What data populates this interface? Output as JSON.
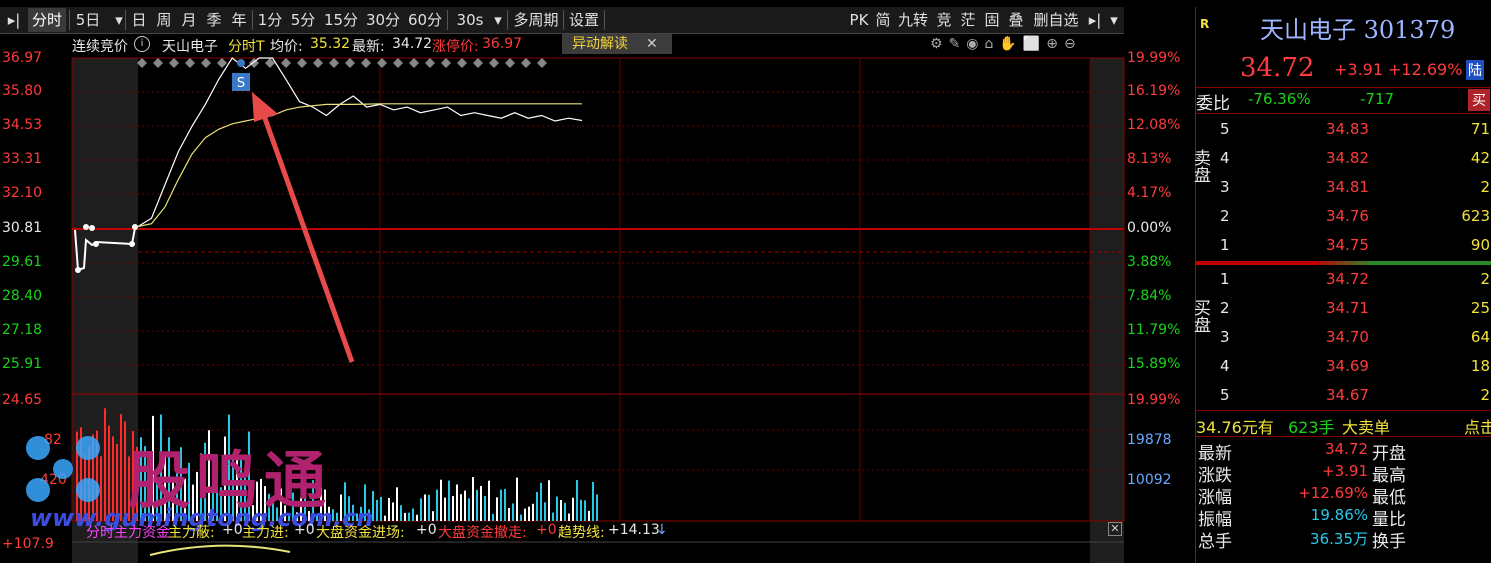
{
  "toolbar": {
    "items": [
      "分时",
      "5日",
      "日",
      "周",
      "月",
      "季",
      "年",
      "1分",
      "5分",
      "15分",
      "30分",
      "60分",
      "30s",
      "多周期",
      "设置"
    ],
    "right_items": [
      "PK",
      "简",
      "九转",
      "竞",
      "茫",
      "固",
      "叠",
      "删自选"
    ]
  },
  "info": {
    "auction": "连续竞价",
    "name": "天山电子",
    "mode": "分时T",
    "avg_label": "均价:",
    "avg": "35.32",
    "last_label": "最新:",
    "last": "34.72",
    "limit_label": "涨停价:",
    "limit": "36.97",
    "anomaly": "异动解读"
  },
  "axes": {
    "left_price": [
      "36.97",
      "35.80",
      "34.53",
      "33.31",
      "32.10",
      "30.81",
      "29.61",
      "28.40",
      "27.18",
      "25.91"
    ],
    "right_pct": [
      "19.99%",
      "16.19%",
      "12.08%",
      "8.13%",
      "4.17%",
      "0.00%",
      "3.88%",
      "7.84%",
      "11.79%",
      "15.89%"
    ],
    "vol_left": [
      "24.65",
      "82",
      "420",
      "+107.9"
    ],
    "vol_right": [
      "19.99%",
      "19878",
      "10092"
    ]
  },
  "chart_data": {
    "type": "line",
    "title": "",
    "ylim": [
      25.91,
      36.97
    ],
    "prev_close": 30.81,
    "series": [
      {
        "name": "",
        "values": [
          30.9,
          31.2,
          32.4,
          33.6,
          34.5,
          35.3,
          36.2,
          36.97,
          36.6,
          36.97,
          36.97,
          36.2,
          35.4,
          35.2,
          34.9,
          35.3,
          35.6,
          35.2,
          35.3,
          35.1,
          35.2,
          35.0,
          35.1,
          35.2,
          34.9,
          35.0,
          34.9,
          34.8,
          35.0,
          34.8,
          34.9,
          34.7,
          34.8,
          34.72
        ]
      },
      {
        "name": "",
        "values": [
          30.9,
          31.0,
          31.6,
          32.6,
          33.5,
          34.1,
          34.4,
          34.6,
          34.7,
          34.8,
          34.9,
          35.1,
          35.2,
          35.25,
          35.3,
          35.3,
          35.3,
          35.31,
          35.32,
          35.32,
          35.32,
          35.32,
          35.32,
          35.32,
          35.32,
          35.32,
          35.32,
          35.32,
          35.32,
          35.32,
          35.32,
          35.32,
          35.32,
          35.32
        ]
      }
    ]
  },
  "marker": "S",
  "indicator": {
    "text1": "分时主力资金",
    "text2": "主力蔽:",
    "v2": "+0",
    "text3": "主力进:",
    "v3": "+0",
    "text4": "大盘资金进场:",
    "v4": "+0",
    "text5": "大盘资金撤走:",
    "v5": "+0",
    "text6": "趋势线:",
    "v6": "+14.13"
  },
  "watermark": {
    "text": "股鸣通",
    "url": "www.gumingtong.com.cn"
  },
  "quote": {
    "badge": "R",
    "title": "天山电子 301379",
    "price": "34.72",
    "chg": "+3.91",
    "pct": "+12.69%",
    "tag": "陆",
    "weibi_label": "委比",
    "weibi": "-76.36%",
    "weicha": "-717",
    "buy_btn": "买",
    "sell_label": "卖盘",
    "buy_label": "买盘",
    "asks": [
      {
        "lvl": "5",
        "price": "34.83",
        "vol": "71"
      },
      {
        "lvl": "4",
        "price": "34.82",
        "vol": "42"
      },
      {
        "lvl": "3",
        "price": "34.81",
        "vol": "2"
      },
      {
        "lvl": "2",
        "price": "34.76",
        "vol": "623"
      },
      {
        "lvl": "1",
        "price": "34.75",
        "vol": "90"
      }
    ],
    "bids": [
      {
        "lvl": "1",
        "price": "34.72",
        "vol": "2"
      },
      {
        "lvl": "2",
        "price": "34.71",
        "vol": "25"
      },
      {
        "lvl": "3",
        "price": "34.70",
        "vol": "64"
      },
      {
        "lvl": "4",
        "price": "34.69",
        "vol": "18"
      },
      {
        "lvl": "5",
        "price": "34.67",
        "vol": "2"
      }
    ],
    "bigorder": {
      "price": "34.76元有",
      "vol": "623手",
      "type": "大卖单",
      "more": "点击"
    },
    "stats": [
      {
        "k": "最新",
        "v": "34.72",
        "k2": "开盘"
      },
      {
        "k": "涨跌",
        "v": "+3.91",
        "k2": "最高"
      },
      {
        "k": "涨幅",
        "v": "+12.69%",
        "k2": "最低"
      },
      {
        "k": "振幅",
        "v": "19.86%",
        "k2": "量比"
      },
      {
        "k": "总手",
        "v": "36.35万",
        "k2": "换手"
      }
    ]
  }
}
